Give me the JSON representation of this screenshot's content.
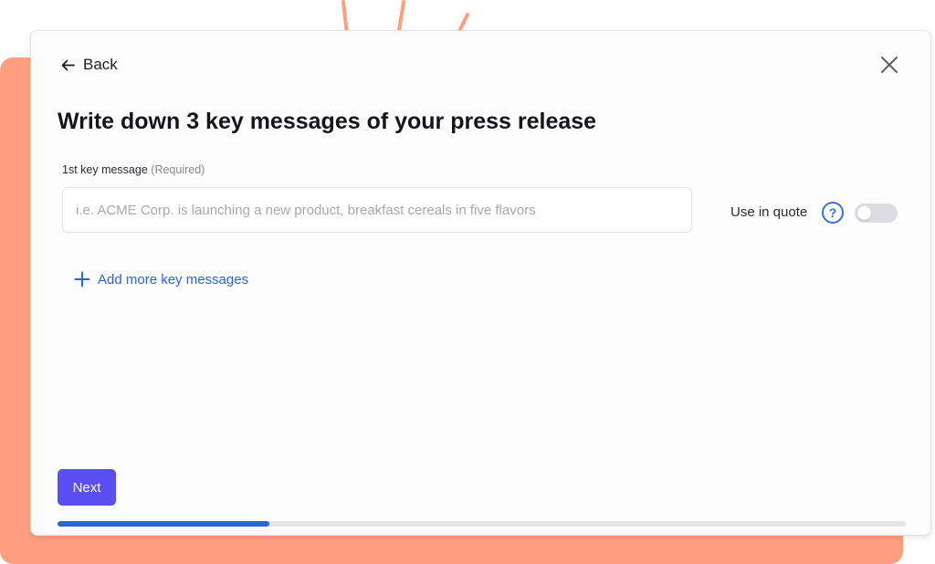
{
  "header": {
    "back_label": "Back",
    "back_icon": "arrow-left-icon",
    "close_icon": "close-icon"
  },
  "title": "Write down 3 key messages of your press release",
  "field": {
    "label": "1st key message",
    "required_note": "(Required)",
    "placeholder": "i.e. ACME Corp. is launching a new product, breakfast cereals in five flavors",
    "value": ""
  },
  "quote": {
    "label": "Use in quote",
    "help_icon": "question-circle-icon",
    "help_glyph": "?",
    "toggle_on": false
  },
  "add_more": {
    "label": "Add more key messages",
    "icon": "plus-icon"
  },
  "next_label": "Next",
  "progress": {
    "fraction": 0.25
  },
  "colors": {
    "accent_blue": "#2f63d3",
    "button_purple": "#5a4ff3",
    "backdrop_coral": "#ff9f7f"
  }
}
